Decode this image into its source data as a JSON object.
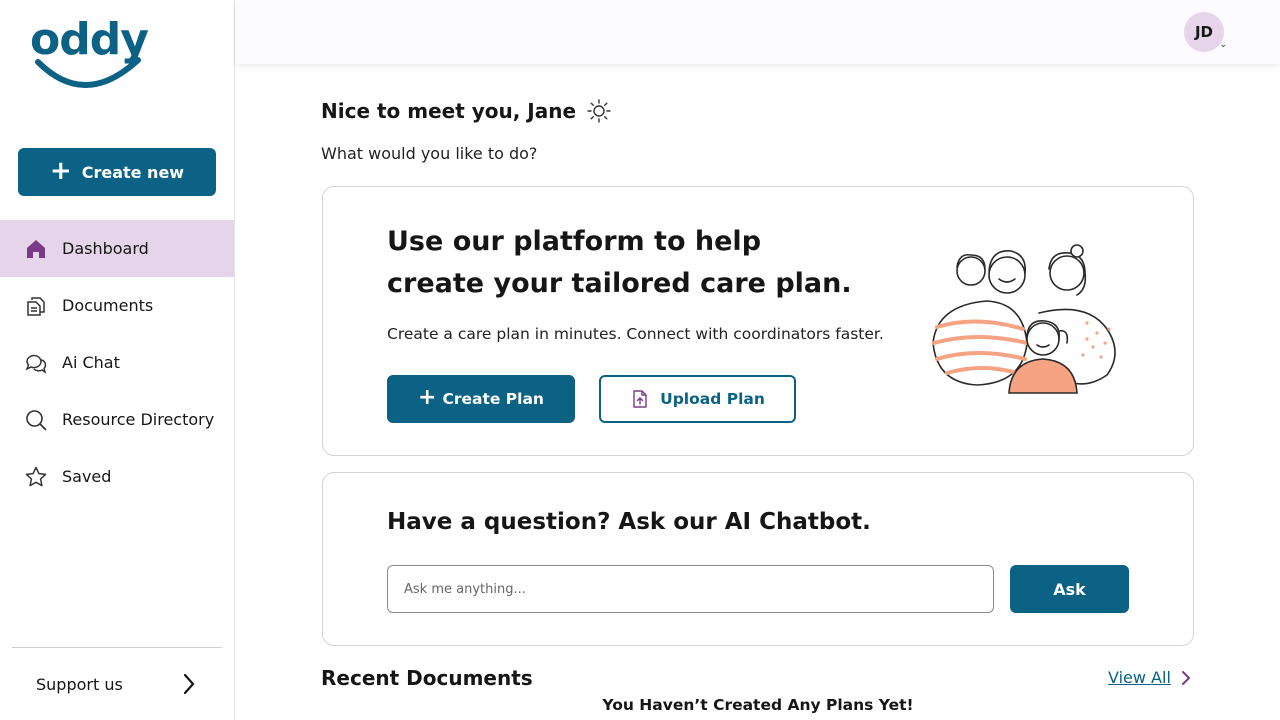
{
  "brand": {
    "logo_text": "oddy",
    "color": "#0b6285"
  },
  "sidebar": {
    "create_label": "Create new",
    "items": [
      {
        "label": "Dashboard",
        "icon": "home-icon",
        "active": true
      },
      {
        "label": "Documents",
        "icon": "documents-icon",
        "active": false
      },
      {
        "label": "Ai Chat",
        "icon": "chat-icon",
        "active": false
      },
      {
        "label": "Resource Directory",
        "icon": "search-icon",
        "active": false
      },
      {
        "label": "Saved",
        "icon": "star-icon",
        "active": false
      }
    ],
    "support_label": "Support us"
  },
  "header": {
    "avatar_initials": "JD"
  },
  "main": {
    "greeting": "Nice to meet you, Jane",
    "subtitle": "What would you like to do?",
    "hero": {
      "title_line1": "Use our platform to help",
      "title_line2": "create your tailored care plan.",
      "subtitle": "Create a care plan in minutes. Connect with coordinators faster.",
      "create_plan_label": "Create Plan",
      "upload_plan_label": "Upload Plan"
    },
    "chatbot": {
      "title": "Have a question? Ask our AI Chatbot.",
      "placeholder": "Ask me anything...",
      "ask_label": "Ask"
    },
    "recent": {
      "title": "Recent Documents",
      "view_all_label": "View All",
      "empty_message": "You Haven’t Created Any Plans Yet!"
    }
  },
  "colors": {
    "primary": "#0b6285",
    "active_nav": "#e5d4ea",
    "accent_purple": "#7a3b86",
    "illustration_orange": "#f5a382"
  }
}
